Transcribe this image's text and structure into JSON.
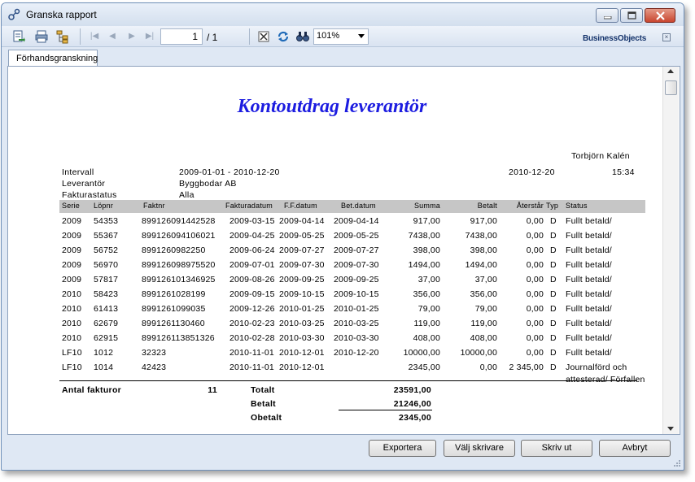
{
  "window": {
    "title": "Granska rapport"
  },
  "toolbar": {
    "page_current": "1",
    "page_total": "/ 1",
    "zoom": "101%",
    "logo": "BusinessObjects"
  },
  "tab": {
    "label": "Förhandsgranskning"
  },
  "report": {
    "title": "Kontoutdrag leverantör",
    "user": "Torbjörn Kalén",
    "print_date": "2010-12-20",
    "print_time": "15:34",
    "filters": [
      {
        "label": "Intervall",
        "value": "2009-01-01 - 2010-12-20"
      },
      {
        "label": "Leverantör",
        "value": "Byggbodar AB"
      },
      {
        "label": "Fakturastatus",
        "value": "Alla"
      }
    ],
    "columns": [
      "Serie",
      "Löpnr",
      "Faktnr",
      "Fakturadatum",
      "F.F.datum",
      "Bet.datum",
      "Summa",
      "Betalt",
      "Återstår",
      "Typ",
      "Status"
    ],
    "rows": [
      {
        "serie": "2009",
        "lopnr": "54353",
        "faktnr": "899126091442528",
        "fakturadatum": "2009-03-15",
        "ffdatum": "2009-04-14",
        "betdatum": "2009-04-14",
        "summa": "917,00",
        "betalt": "917,00",
        "aterstar": "0,00",
        "typ": "D",
        "status": "Fullt betald/"
      },
      {
        "serie": "2009",
        "lopnr": "55367",
        "faktnr": "899126094106021",
        "fakturadatum": "2009-04-25",
        "ffdatum": "2009-05-25",
        "betdatum": "2009-05-25",
        "summa": "7438,00",
        "betalt": "7438,00",
        "aterstar": "0,00",
        "typ": "D",
        "status": "Fullt betald/"
      },
      {
        "serie": "2009",
        "lopnr": "56752",
        "faktnr": "8991260982250",
        "fakturadatum": "2009-06-24",
        "ffdatum": "2009-07-27",
        "betdatum": "2009-07-27",
        "summa": "398,00",
        "betalt": "398,00",
        "aterstar": "0,00",
        "typ": "D",
        "status": "Fullt betald/"
      },
      {
        "serie": "2009",
        "lopnr": "56970",
        "faktnr": "899126098975520",
        "fakturadatum": "2009-07-01",
        "ffdatum": "2009-07-30",
        "betdatum": "2009-07-30",
        "summa": "1494,00",
        "betalt": "1494,00",
        "aterstar": "0,00",
        "typ": "D",
        "status": "Fullt betald/"
      },
      {
        "serie": "2009",
        "lopnr": "57817",
        "faktnr": "899126101346925",
        "fakturadatum": "2009-08-26",
        "ffdatum": "2009-09-25",
        "betdatum": "2009-09-25",
        "summa": "37,00",
        "betalt": "37,00",
        "aterstar": "0,00",
        "typ": "D",
        "status": "Fullt betald/"
      },
      {
        "serie": "2010",
        "lopnr": "58423",
        "faktnr": "8991261028199",
        "fakturadatum": "2009-09-15",
        "ffdatum": "2009-10-15",
        "betdatum": "2009-10-15",
        "summa": "356,00",
        "betalt": "356,00",
        "aterstar": "0,00",
        "typ": "D",
        "status": "Fullt betald/"
      },
      {
        "serie": "2010",
        "lopnr": "61413",
        "faktnr": "8991261099035",
        "fakturadatum": "2009-12-26",
        "ffdatum": "2010-01-25",
        "betdatum": "2010-01-25",
        "summa": "79,00",
        "betalt": "79,00",
        "aterstar": "0,00",
        "typ": "D",
        "status": "Fullt betald/"
      },
      {
        "serie": "2010",
        "lopnr": "62679",
        "faktnr": "8991261130460",
        "fakturadatum": "2010-02-23",
        "ffdatum": "2010-03-25",
        "betdatum": "2010-03-25",
        "summa": "119,00",
        "betalt": "119,00",
        "aterstar": "0,00",
        "typ": "D",
        "status": "Fullt betald/"
      },
      {
        "serie": "2010",
        "lopnr": "62915",
        "faktnr": "899126113851326",
        "fakturadatum": "2010-02-28",
        "ffdatum": "2010-03-30",
        "betdatum": "2010-03-30",
        "summa": "408,00",
        "betalt": "408,00",
        "aterstar": "0,00",
        "typ": "D",
        "status": "Fullt betald/"
      },
      {
        "serie": "LF10",
        "lopnr": "1012",
        "faktnr": "32323",
        "fakturadatum": "2010-11-01",
        "ffdatum": "2010-12-01",
        "betdatum": "2010-12-20",
        "summa": "10000,00",
        "betalt": "10000,00",
        "aterstar": "0,00",
        "typ": "D",
        "status": "Fullt betald/"
      },
      {
        "serie": "LF10",
        "lopnr": "1014",
        "faktnr": "42423",
        "fakturadatum": "2010-11-01",
        "ffdatum": "2010-12-01",
        "betdatum": "",
        "summa": "2345,00",
        "betalt": "0,00",
        "aterstar": "2 345,00",
        "typ": "D",
        "status": "Journalförd och",
        "status2": "attesterad/ Förfallen"
      }
    ],
    "footer": {
      "count_label": "Antal fakturor",
      "count": "11",
      "total_label": "Totalt",
      "total": "23591,00",
      "paid_label": "Betalt",
      "paid": "21246,00",
      "unpaid_label": "Obetalt",
      "unpaid": "2345,00"
    }
  },
  "buttons": {
    "export": "Exportera",
    "select_printer": "Välj skrivare",
    "print": "Skriv ut",
    "cancel": "Avbryt"
  }
}
